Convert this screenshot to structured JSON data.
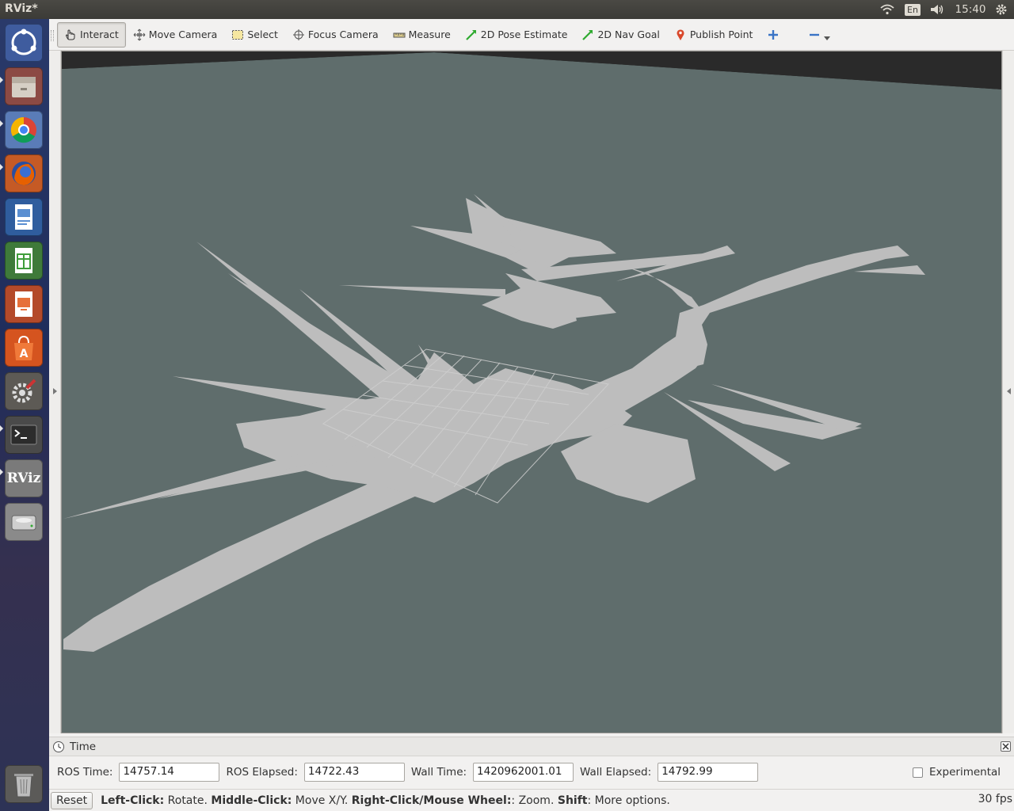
{
  "topbar": {
    "app_title": "RViz*",
    "keyboard_layout": "En",
    "clock": "15:40"
  },
  "launcher": {
    "items": [
      {
        "name": "ubuntu-dash-icon"
      },
      {
        "name": "files-icon"
      },
      {
        "name": "chrome-icon"
      },
      {
        "name": "firefox-icon"
      },
      {
        "name": "writer-icon"
      },
      {
        "name": "calc-icon"
      },
      {
        "name": "impress-icon"
      },
      {
        "name": "software-center-icon"
      },
      {
        "name": "system-settings-icon"
      },
      {
        "name": "terminal-icon"
      },
      {
        "name": "rviz-icon",
        "label": "RViz"
      },
      {
        "name": "drive-icon"
      },
      {
        "name": "trash-icon"
      }
    ]
  },
  "toolbar": {
    "tools": [
      {
        "label": "Interact",
        "icon": "hand-icon",
        "active": true
      },
      {
        "label": "Move Camera",
        "icon": "move-icon"
      },
      {
        "label": "Select",
        "icon": "select-icon"
      },
      {
        "label": "Focus Camera",
        "icon": "crosshair-icon"
      },
      {
        "label": "Measure",
        "icon": "ruler-icon"
      },
      {
        "label": "2D Pose Estimate",
        "icon": "green-arrow-icon"
      },
      {
        "label": "2D Nav Goal",
        "icon": "green-arrow-icon"
      },
      {
        "label": "Publish Point",
        "icon": "map-pin-icon"
      }
    ]
  },
  "time_panel": {
    "title": "Time",
    "ros_time_label": "ROS Time:",
    "ros_time": "14757.14",
    "ros_elapsed_label": "ROS Elapsed:",
    "ros_elapsed": "14722.43",
    "wall_time_label": "Wall Time:",
    "wall_time": "1420962001.01",
    "wall_elapsed_label": "Wall Elapsed:",
    "wall_elapsed": "14792.99",
    "experimental_label": "Experimental"
  },
  "status": {
    "reset_label": "Reset",
    "left_click": "Left-Click:",
    "left_click_action": " Rotate. ",
    "middle_click": "Middle-Click:",
    "middle_click_action": " Move X/Y. ",
    "right_click": "Right-Click/Mouse Wheel:",
    "right_click_action": ": Zoom. ",
    "shift": "Shift",
    "shift_action": ": More options.",
    "fps": "30 fps"
  },
  "colors": {
    "viewport_bg": "#5f6d6c",
    "map_free": "#bdbdbd",
    "grid_line": "#c9c9c9"
  }
}
